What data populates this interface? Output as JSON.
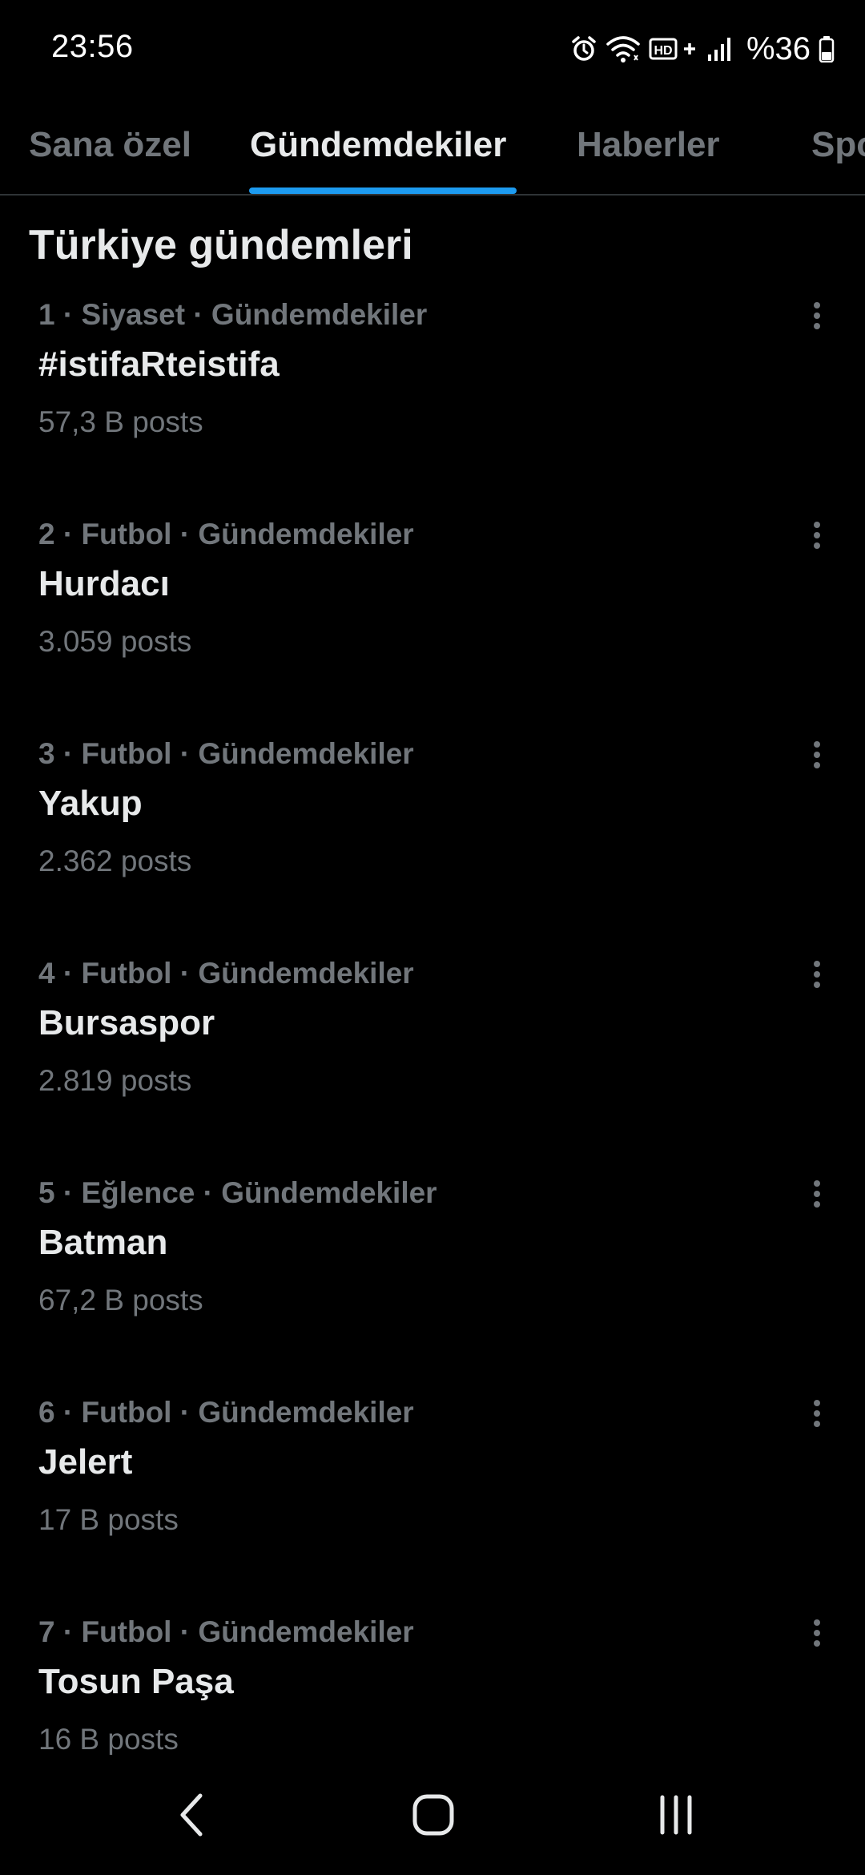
{
  "status_bar": {
    "time": "23:56",
    "battery": "%36",
    "icons": [
      "alarm-icon",
      "wifi-icon",
      "volte-icon",
      "signal-icon",
      "battery-icon"
    ]
  },
  "tabs": [
    {
      "label": "Sana özel",
      "active": false
    },
    {
      "label": "Gündemdekiler",
      "active": true
    },
    {
      "label": "Haberler",
      "active": false
    },
    {
      "label": "Spor",
      "active": false
    }
  ],
  "section": {
    "title": "Türkiye gündemleri"
  },
  "trends": [
    {
      "meta": "1 · Siyaset · Gündemdekiler",
      "name": "#istifaRteistifa",
      "count": "57,3 B posts"
    },
    {
      "meta": "2 · Futbol · Gündemdekiler",
      "name": "Hurdacı",
      "count": "3.059 posts"
    },
    {
      "meta": "3 · Futbol · Gündemdekiler",
      "name": "Yakup",
      "count": "2.362 posts"
    },
    {
      "meta": "4 · Futbol · Gündemdekiler",
      "name": "Bursaspor",
      "count": "2.819 posts"
    },
    {
      "meta": "5 · Eğlence · Gündemdekiler",
      "name": "Batman",
      "count": "67,2 B posts"
    },
    {
      "meta": "6 · Futbol · Gündemdekiler",
      "name": "Jelert",
      "count": "17 B posts"
    },
    {
      "meta": "7 · Futbol · Gündemdekiler",
      "name": "Tosun Paşa",
      "count": "16 B posts"
    }
  ],
  "nav_bar": {
    "icons": [
      "back-icon",
      "home-icon",
      "recents-icon"
    ]
  },
  "colors": {
    "background": "#000000",
    "primary_text": "#e7e9ea",
    "secondary_text": "#71767b",
    "accent": "#1d9bf0",
    "divider": "#2f3336"
  }
}
